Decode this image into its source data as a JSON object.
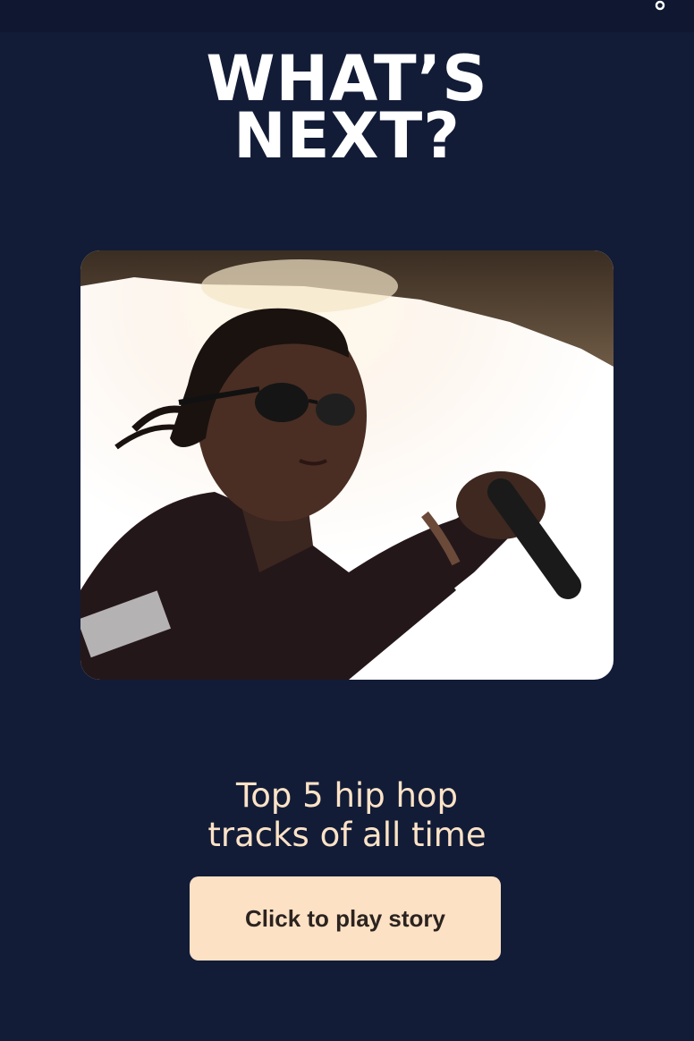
{
  "header": {
    "share_icon": "share-icon"
  },
  "headline": {
    "line1": "WHAT’S",
    "line2": "NEXT?"
  },
  "story": {
    "image_icon": "photo-rapper-with-microphone",
    "title_line1": "Top 5 hip hop",
    "title_line2": "tracks of all time",
    "play_label": "Click to play story"
  },
  "colors": {
    "background": "#121c37",
    "accent": "#fde1c4",
    "headline": "#ffffff",
    "title": "#fde3c7"
  }
}
